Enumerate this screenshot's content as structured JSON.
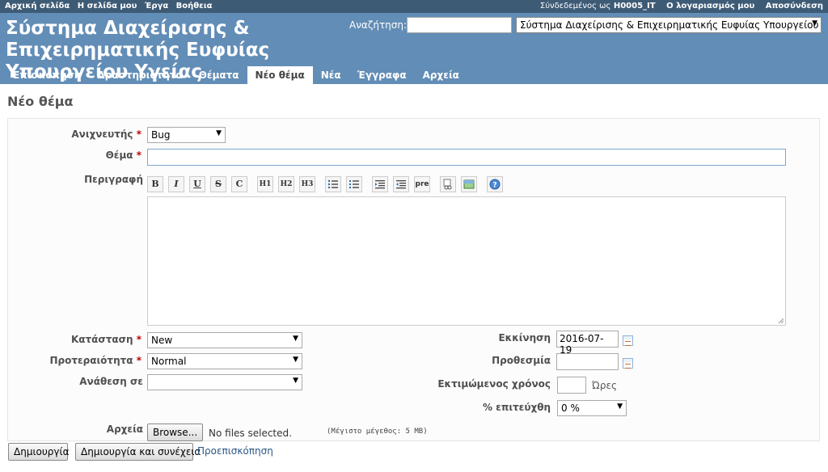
{
  "top_menu": {
    "left": [
      "Αρχική σελίδα",
      "Η σελίδα μου",
      "Έργα",
      "Βοήθεια"
    ],
    "logged_in_as": "Σύνδεδεμένος ως",
    "username": "H0005_IT",
    "my_account": "Ο λογαριασμός μου",
    "logout": "Αποσύνδεση"
  },
  "header": {
    "title": "Σύστημα Διαχείρισης & Επιχειρηματικής Ευφυίας Υπουργείου Υγείας",
    "search_label": "Αναζήτηση:",
    "search_value": "",
    "project_selected": "Σύστημα Διαχείρισης & Επιχειρηματικής Ευφυίας Υπουργείου Υγείας"
  },
  "tabs": [
    {
      "label": "Επισκόπηση"
    },
    {
      "label": "Δραστηριότητα"
    },
    {
      "label": "Θέματα"
    },
    {
      "label": "Νέο θέμα",
      "active": true
    },
    {
      "label": "Νέα"
    },
    {
      "label": "Έγγραφα"
    },
    {
      "label": "Αρχεία"
    }
  ],
  "page_title": "Νέο θέμα",
  "form": {
    "tracker_label": "Ανιχνευτής",
    "tracker_value": "Bug",
    "subject_label": "Θέμα",
    "subject_value": "",
    "description_label": "Περιγραφή",
    "toolbar": [
      "B",
      "I",
      "U",
      "S",
      "C",
      "H1",
      "H2",
      "H3",
      "pre"
    ],
    "status_label": "Κατάσταση",
    "status_value": "New",
    "priority_label": "Προτεραιότητα",
    "priority_value": "Normal",
    "assignee_label": "Ανάθεση σε",
    "assignee_value": "",
    "start_label": "Εκκίνηση",
    "start_value": "2016-07-19",
    "due_label": "Προθεσμία",
    "due_value": "",
    "estimated_label": "Εκτιμώμενος χρόνος",
    "estimated_value": "",
    "hours_unit": "Ώρες",
    "done_label": "% επιτεύχθη",
    "done_value": "0 %",
    "files_label": "Αρχεία",
    "browse_label": "Browse...",
    "no_files": "No files selected.",
    "max_size": "(Μέγιστο μέγεθος: 5 MB)"
  },
  "actions": {
    "create": "Δημιουργία",
    "create_continue": "Δημιουργία και συνέχεια",
    "preview": "Προεπισκόπηση"
  },
  "colors": {
    "top_bar": "#3e5b76",
    "header": "#628db6",
    "required": "#bb0000"
  }
}
